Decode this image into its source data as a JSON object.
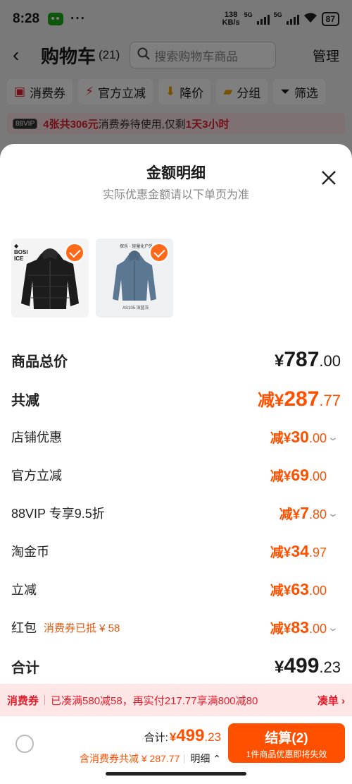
{
  "status": {
    "time": "8:28",
    "dots": "···",
    "net_speed_top": "138",
    "net_speed_bottom": "KB/s",
    "sig1": "5G",
    "sig2": "5G",
    "battery": "87"
  },
  "header": {
    "title": "购物车",
    "count": "(21)",
    "search_placeholder": "搜索购物车商品",
    "manage": "管理"
  },
  "filters": [
    {
      "label": "消费券",
      "icon": "coupon-icon"
    },
    {
      "label": "官方立减",
      "icon": "bolt-icon"
    },
    {
      "label": "降价",
      "icon": "price-drop-icon"
    },
    {
      "label": "分组",
      "icon": "folder-icon"
    },
    {
      "label": "筛选",
      "icon": "filter-icon"
    }
  ],
  "vip_bar": {
    "tag": "88VIP",
    "red1": "4张共306元",
    "mid": "消费券待使用,仅剩",
    "red2": "1天3小时"
  },
  "sheet": {
    "title": "金额明细",
    "subtitle": "实际优惠金额请以下单页为准",
    "product2_top": "探乐 · 轻量化户外",
    "product2_caption": "AS105 深蓝灰",
    "product1_brand": "BOSI\nDEN ICE"
  },
  "rows": [
    {
      "label": "商品总价",
      "prefix": "¥",
      "int": "787",
      "dec": ".00"
    },
    {
      "label": "共减",
      "prefix": "减¥",
      "int": "287",
      "dec": ".77"
    },
    {
      "label": "店铺优惠",
      "prefix": "减¥",
      "int": "30",
      "dec": ".00"
    },
    {
      "label": "官方立减",
      "prefix": "减¥",
      "int": "69",
      "dec": ".00"
    },
    {
      "label": "88VIP 专享9.5折",
      "prefix": "减¥",
      "int": "7",
      "dec": ".80"
    },
    {
      "label": "淘金币",
      "prefix": "减¥",
      "int": "34",
      "dec": ".97"
    },
    {
      "label": "立减",
      "prefix": "减¥",
      "int": "63",
      "dec": ".00"
    },
    {
      "label": "红包",
      "note": "消费券已抵 ¥ 58",
      "prefix": "减¥",
      "int": "83",
      "dec": ".00"
    },
    {
      "label": "合计",
      "prefix": "¥",
      "int": "499",
      "dec": ".23"
    }
  ],
  "promo": {
    "tag": "消费券",
    "text": "已凑满580减58，再实付217.77享满800减80",
    "action": "凑单"
  },
  "footer": {
    "total_label": "合计:",
    "total_prefix": "¥",
    "total_int": "499",
    "total_dec": ".23",
    "discount_text": "含消费券共减 ¥ 287.77",
    "detail": "明细",
    "checkout": "结算(2)",
    "checkout_sub": "1件商品优惠即将失效"
  },
  "colors": {
    "accent": "#ff5000",
    "red": "#e4202e"
  }
}
